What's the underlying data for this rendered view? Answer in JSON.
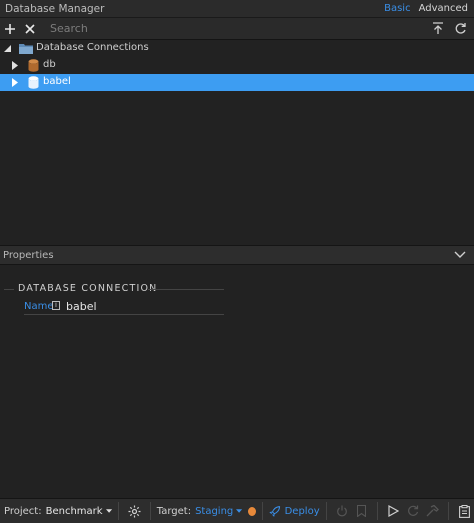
{
  "window": {
    "title": "Database Manager",
    "mode_basic": "Basic",
    "mode_advanced": "Advanced"
  },
  "toolbar": {
    "search_placeholder": "Search"
  },
  "tree": {
    "root_label": "Database Connections",
    "items": [
      {
        "label": "db",
        "selected": false
      },
      {
        "label": "babel",
        "selected": true
      }
    ]
  },
  "properties": {
    "header": "Properties",
    "section_title": "DATABASE CONNECTION",
    "field_label": "Name",
    "field_info": "i",
    "field_value": "babel"
  },
  "statusbar": {
    "project_label": "Project:",
    "project_value": "Benchmark",
    "target_label": "Target:",
    "target_value": "Staging",
    "deploy_label": "Deploy"
  },
  "colors": {
    "accent": "#3a8ee6",
    "selection": "#3d9df2",
    "status_dot": "#e7893a",
    "db_orange": "#c77a3b"
  }
}
